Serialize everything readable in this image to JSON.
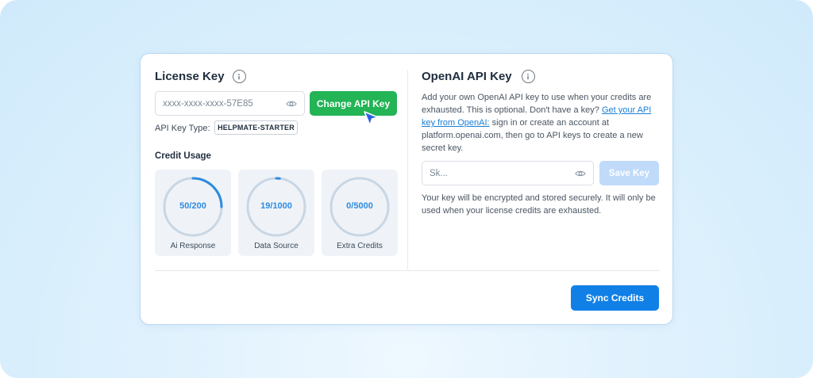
{
  "license": {
    "title": "License Key",
    "key_value": "xxxx-xxxx-xxxx-57E85",
    "change_button": "Change API Key",
    "key_type_label": "API Key Type:",
    "key_type_value": "HELPMATE-STARTER"
  },
  "credit_usage": {
    "title": "Credit Usage",
    "items": [
      {
        "label": "Ai Response",
        "value_text": "50/200",
        "fraction": 0.25
      },
      {
        "label": "Data Source",
        "value_text": "19/1000",
        "fraction": 0.019
      },
      {
        "label": "Extra Credits",
        "value_text": "0/5000",
        "fraction": 0
      }
    ]
  },
  "openai": {
    "title": "OpenAI API Key",
    "desc_pre": "Add your own OpenAI API key to use when your credits are exhausted. This is optional. Don't have a key? ",
    "desc_link": "Get your API key from OpenAI:",
    "desc_post": " sign in or create an account at platform.openai.com, then go to API keys to create a new secret key.",
    "input_placeholder": "Sk...",
    "save_button": "Save Key",
    "secure_note": "Your key will be encrypted and stored securely. It will only be used when your license credits are exhausted."
  },
  "footer": {
    "sync_button": "Sync Credits"
  },
  "icons": {
    "info": "info-icon",
    "eye": "eye-icon",
    "cursor": "cursor-pointer-icon"
  },
  "colors": {
    "accent_green": "#22b455",
    "accent_blue": "#1180e6",
    "ring_track": "#c9d6e3",
    "ring_progress": "#2e8be0",
    "disabled_button": "#c0dafa"
  }
}
